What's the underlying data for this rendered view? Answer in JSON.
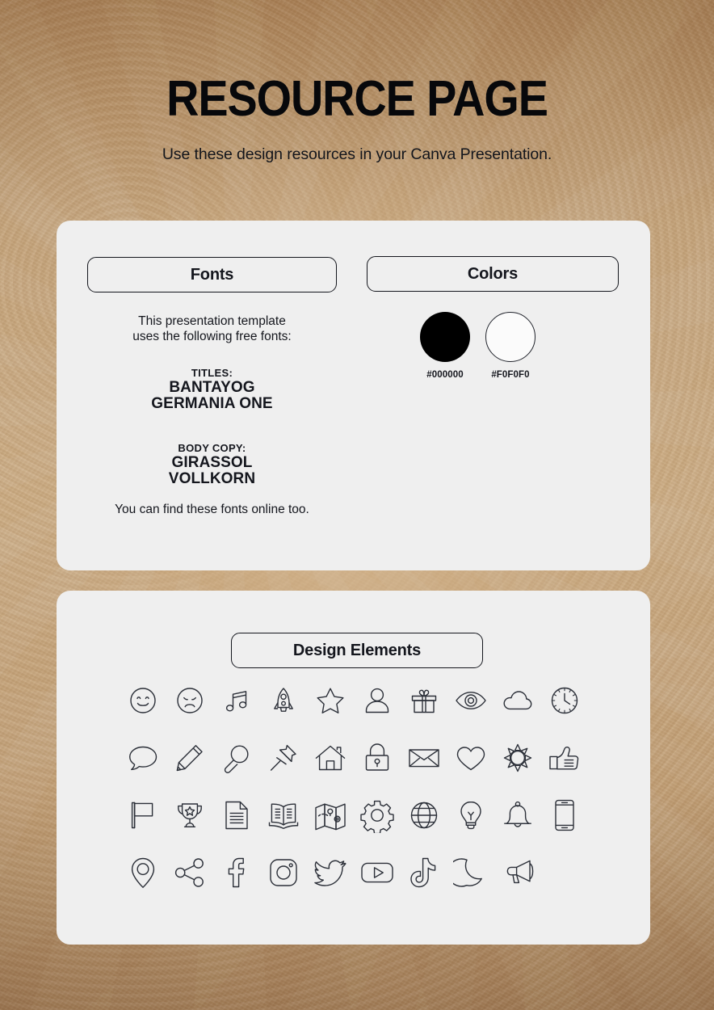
{
  "header": {
    "title": "RESOURCE PAGE",
    "subtitle": "Use these design resources in your Canva Presentation."
  },
  "resources_card": {
    "fonts": {
      "heading": "Fonts",
      "intro": "This presentation template uses the following free fonts:",
      "intro_line1": "This presentation template",
      "intro_line2": "uses the following free fonts:",
      "groups": [
        {
          "label": "TITLES:",
          "names": [
            "BANTAYOG",
            "GERMANIA ONE"
          ]
        },
        {
          "label": "BODY COPY:",
          "names": [
            "GIRASSOL",
            "VOLLKORN"
          ]
        }
      ],
      "footer": "You can find these fonts online too."
    },
    "colors": {
      "heading": "Colors",
      "swatches": [
        {
          "label": "#000000",
          "hex": "#000000",
          "style": "filled"
        },
        {
          "label": "#F0F0F0",
          "hex": "#F0F0F0",
          "style": "outlined"
        }
      ]
    }
  },
  "design_card": {
    "heading": "Design Elements",
    "icons": [
      "smiley-face-icon",
      "sad-face-icon",
      "music-note-icon",
      "rocket-icon",
      "star-icon",
      "user-icon",
      "gift-icon",
      "eye-icon",
      "cloud-icon",
      "clock-icon",
      "speech-bubble-icon",
      "pencil-icon",
      "magnifying-glass-icon",
      "push-pin-icon",
      "house-icon",
      "padlock-icon",
      "envelope-icon",
      "heart-icon",
      "sun-icon",
      "thumbs-up-icon",
      "flag-icon",
      "trophy-icon",
      "document-icon",
      "open-book-icon",
      "map-icon",
      "gear-icon",
      "globe-icon",
      "lightbulb-icon",
      "bell-icon",
      "smartphone-icon",
      "location-pin-icon",
      "share-icon",
      "facebook-icon",
      "instagram-icon",
      "twitter-icon",
      "youtube-icon",
      "tiktok-icon",
      "moon-icon",
      "megaphone-icon"
    ]
  },
  "theme": {
    "card_background": "#EFEFEF",
    "text_color": "#14161D",
    "page_background": "#C3A37B"
  }
}
